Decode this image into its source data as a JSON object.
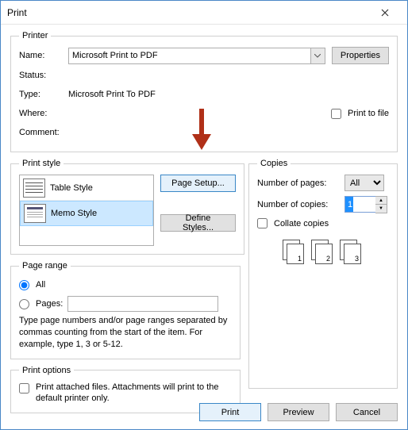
{
  "window": {
    "title": "Print"
  },
  "printer": {
    "legend": "Printer",
    "name_label": "Name:",
    "name_value": "Microsoft Print to PDF",
    "status_label": "Status:",
    "status_value": "",
    "type_label": "Type:",
    "type_value": "Microsoft Print To PDF",
    "where_label": "Where:",
    "where_value": "",
    "comment_label": "Comment:",
    "comment_value": "",
    "properties_btn": "Properties",
    "print_to_file": "Print to file"
  },
  "print_style": {
    "legend": "Print style",
    "items": [
      {
        "label": "Table Style",
        "selected": false
      },
      {
        "label": "Memo Style",
        "selected": true
      }
    ],
    "page_setup_btn": "Page Setup...",
    "define_styles_btn": "Define Styles..."
  },
  "copies": {
    "legend": "Copies",
    "pages_label": "Number of pages:",
    "pages_value": "All",
    "copies_label": "Number of copies:",
    "copies_value": "1",
    "collate_label": "Collate copies",
    "stack_labels": [
      "1",
      "2",
      "3"
    ]
  },
  "page_range": {
    "legend": "Page range",
    "all_label": "All",
    "pages_label": "Pages:",
    "pages_value": "",
    "hint": "Type page numbers and/or page ranges separated by commas counting from the start of the item.  For example, type 1, 3 or 5-12."
  },
  "print_options": {
    "legend": "Print options",
    "attached_label": "Print attached files.  Attachments will print to the default printer only."
  },
  "footer": {
    "print": "Print",
    "preview": "Preview",
    "cancel": "Cancel"
  }
}
